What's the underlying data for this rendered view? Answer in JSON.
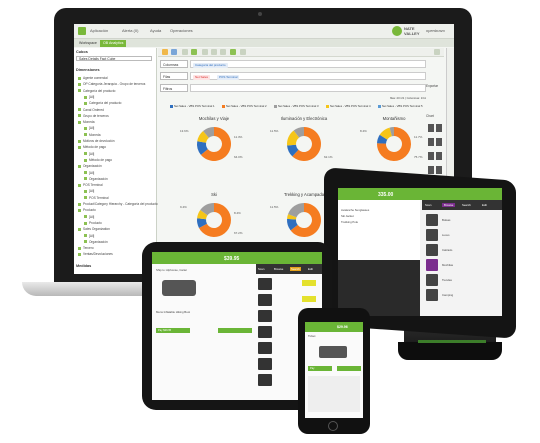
{
  "laptop": {
    "topbar": {
      "items": [
        "Aplicación",
        "Alerta (0)",
        "Ayuda",
        "Operaciones"
      ],
      "logo_line1": "NATE",
      "logo_line2": "VALLEY",
      "brand": "openbravo"
    },
    "tabs": [
      "Workspace",
      "OB Analytics"
    ],
    "sidebar": {
      "cubes_header": "Cubos",
      "cube_value": "Sales Details Fact Cube",
      "dimensions_header": "Dimensiones",
      "tree": [
        "Agente comercial",
        "OP Categoría Jerarquía - Grupo de terceros",
        "Categoría del producto",
        "[All]",
        "Categoría del producto",
        "Canal Ordered",
        "Grupo de terceros",
        "Moneda",
        "[All]",
        "Moneda",
        "Motivos de devolución",
        "Método de pago",
        "[All]",
        "Método de pago",
        "Organización",
        "[All]",
        "Organización",
        "POS Terminal",
        "[All]",
        "POS Terminal",
        "Product/Category Hierarchy - Categoría del producto",
        "Producto",
        "[All]",
        "Producto",
        "Sales Organization",
        "[All]",
        "Organización",
        "Tercero",
        "Ventas/Devoluciones"
      ],
      "measures_header": "Medidas"
    },
    "filters": {
      "columns_label": "Columnas",
      "columns_chip": "Categoría del producto",
      "rows_label": "Filas",
      "rows_chip1": "Net Sales",
      "rows_chip2": "POS Terminal",
      "filters_label": "Filtros",
      "status": "filas: 20 /21 | Columnas: 1/11"
    },
    "legend": [
      {
        "label": "Net Sales - VBS POS Terminal 1",
        "color": "#2f6fbf"
      },
      {
        "label": "Net Sales - VBS POS Terminal 2",
        "color": "#f57c20"
      },
      {
        "label": "Net Sales - VBS POS Terminal 3",
        "color": "#9e9e9e"
      },
      {
        "label": "Net Sales - VBS POS Terminal 4",
        "color": "#f5c518"
      },
      {
        "label": "Net Sales - VBS POS Terminal 5",
        "color": "#5b9bd5"
      }
    ],
    "charts": [
      {
        "title": "Mochilas y Viaje",
        "labels": [
          "13.6%",
          "11.3%",
          "64.0%"
        ]
      },
      {
        "title": "Iluminación y Electrónica",
        "labels": [
          "11.5%",
          "62.1%"
        ]
      },
      {
        "title": "Montañismo",
        "labels": [
          "8.4%",
          "11.7%",
          "75.7%"
        ]
      },
      {
        "title": "Ski",
        "labels": [
          "9.4%",
          "8.4%",
          "67.2%"
        ]
      },
      {
        "title": "Trekking y Acampada",
        "labels": [
          "11.5%",
          "4.6%",
          "64.5%"
        ]
      }
    ],
    "right_panel": [
      "Exportar",
      "Chart"
    ]
  },
  "tablet": {
    "total": "335.00",
    "tabs": [
      "Scan",
      "Browse",
      "Search",
      "Edit"
    ],
    "lines": [
      "Avalanche Sunglasses",
      "Ski Jacket",
      "Trekking Pole"
    ],
    "categories": [
      "Bolsas",
      "Luces",
      "Calzado",
      "Mochilas",
      "Tiendas",
      "Camping"
    ]
  },
  "ipad": {
    "total": "$39.95",
    "buttons": [
      "Scan",
      "Browse",
      "Search",
      "Edit"
    ],
    "product": "Mens Inflatable Hiking Boot",
    "ticket_line": "Ship to: Alphonse, Carter",
    "payment": "Pay $39.95"
  },
  "phone": {
    "total": "$29.96",
    "title": "Ticket",
    "pay": "Pay"
  },
  "colors": {
    "accent_green": "#6ab536",
    "donut_blue": "#2f6fbf",
    "donut_orange": "#f57c20",
    "donut_grey": "#9e9e9e",
    "donut_yellow": "#f5c518"
  }
}
